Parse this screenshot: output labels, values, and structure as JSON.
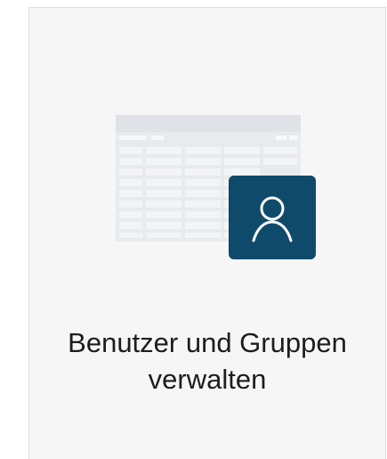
{
  "tile": {
    "title_line1": "Benutzer und Gruppen",
    "title_line2": "verwalten",
    "icon": "user-icon",
    "illustration": "spreadsheet-table",
    "colors": {
      "card_background": "#f6f6f6",
      "badge_background": "#0f4a6b",
      "table_grid": "#e3e6ea"
    }
  }
}
